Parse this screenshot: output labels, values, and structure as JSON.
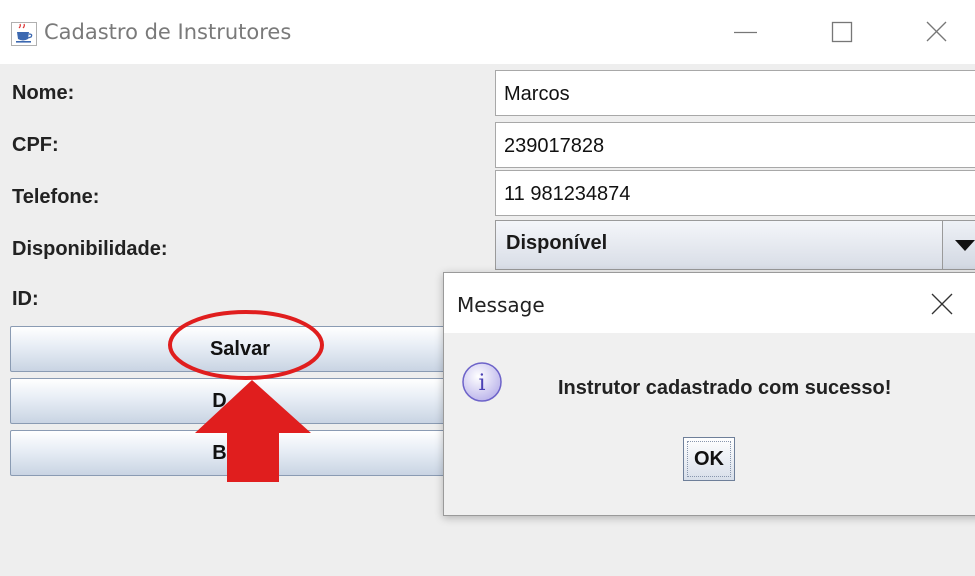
{
  "window": {
    "title": "Cadastro de Instrutores",
    "icon": "java-cup-icon",
    "controls": [
      "minimize-icon",
      "maximize-icon",
      "close-icon"
    ]
  },
  "form": {
    "nome": {
      "label": "Nome:",
      "value": "Marcos"
    },
    "cpf": {
      "label": "CPF:",
      "value": "239017828"
    },
    "telefone": {
      "label": "Telefone:",
      "value": "11 981234874"
    },
    "disponibilidade": {
      "label": "Disponibilidade:",
      "selected": "Disponível"
    },
    "id": {
      "label": "ID:"
    }
  },
  "buttons": {
    "salvar": "Salvar",
    "second_partial": "D      r",
    "third_partial": "B      r"
  },
  "dialog": {
    "title": "Message",
    "icon": "info-icon",
    "message": "Instrutor cadastrado com sucesso!",
    "ok_label": "OK"
  },
  "annotation": {
    "color": "#e01e1e",
    "shapes": [
      "ellipse-highlight",
      "arrow-up"
    ]
  }
}
